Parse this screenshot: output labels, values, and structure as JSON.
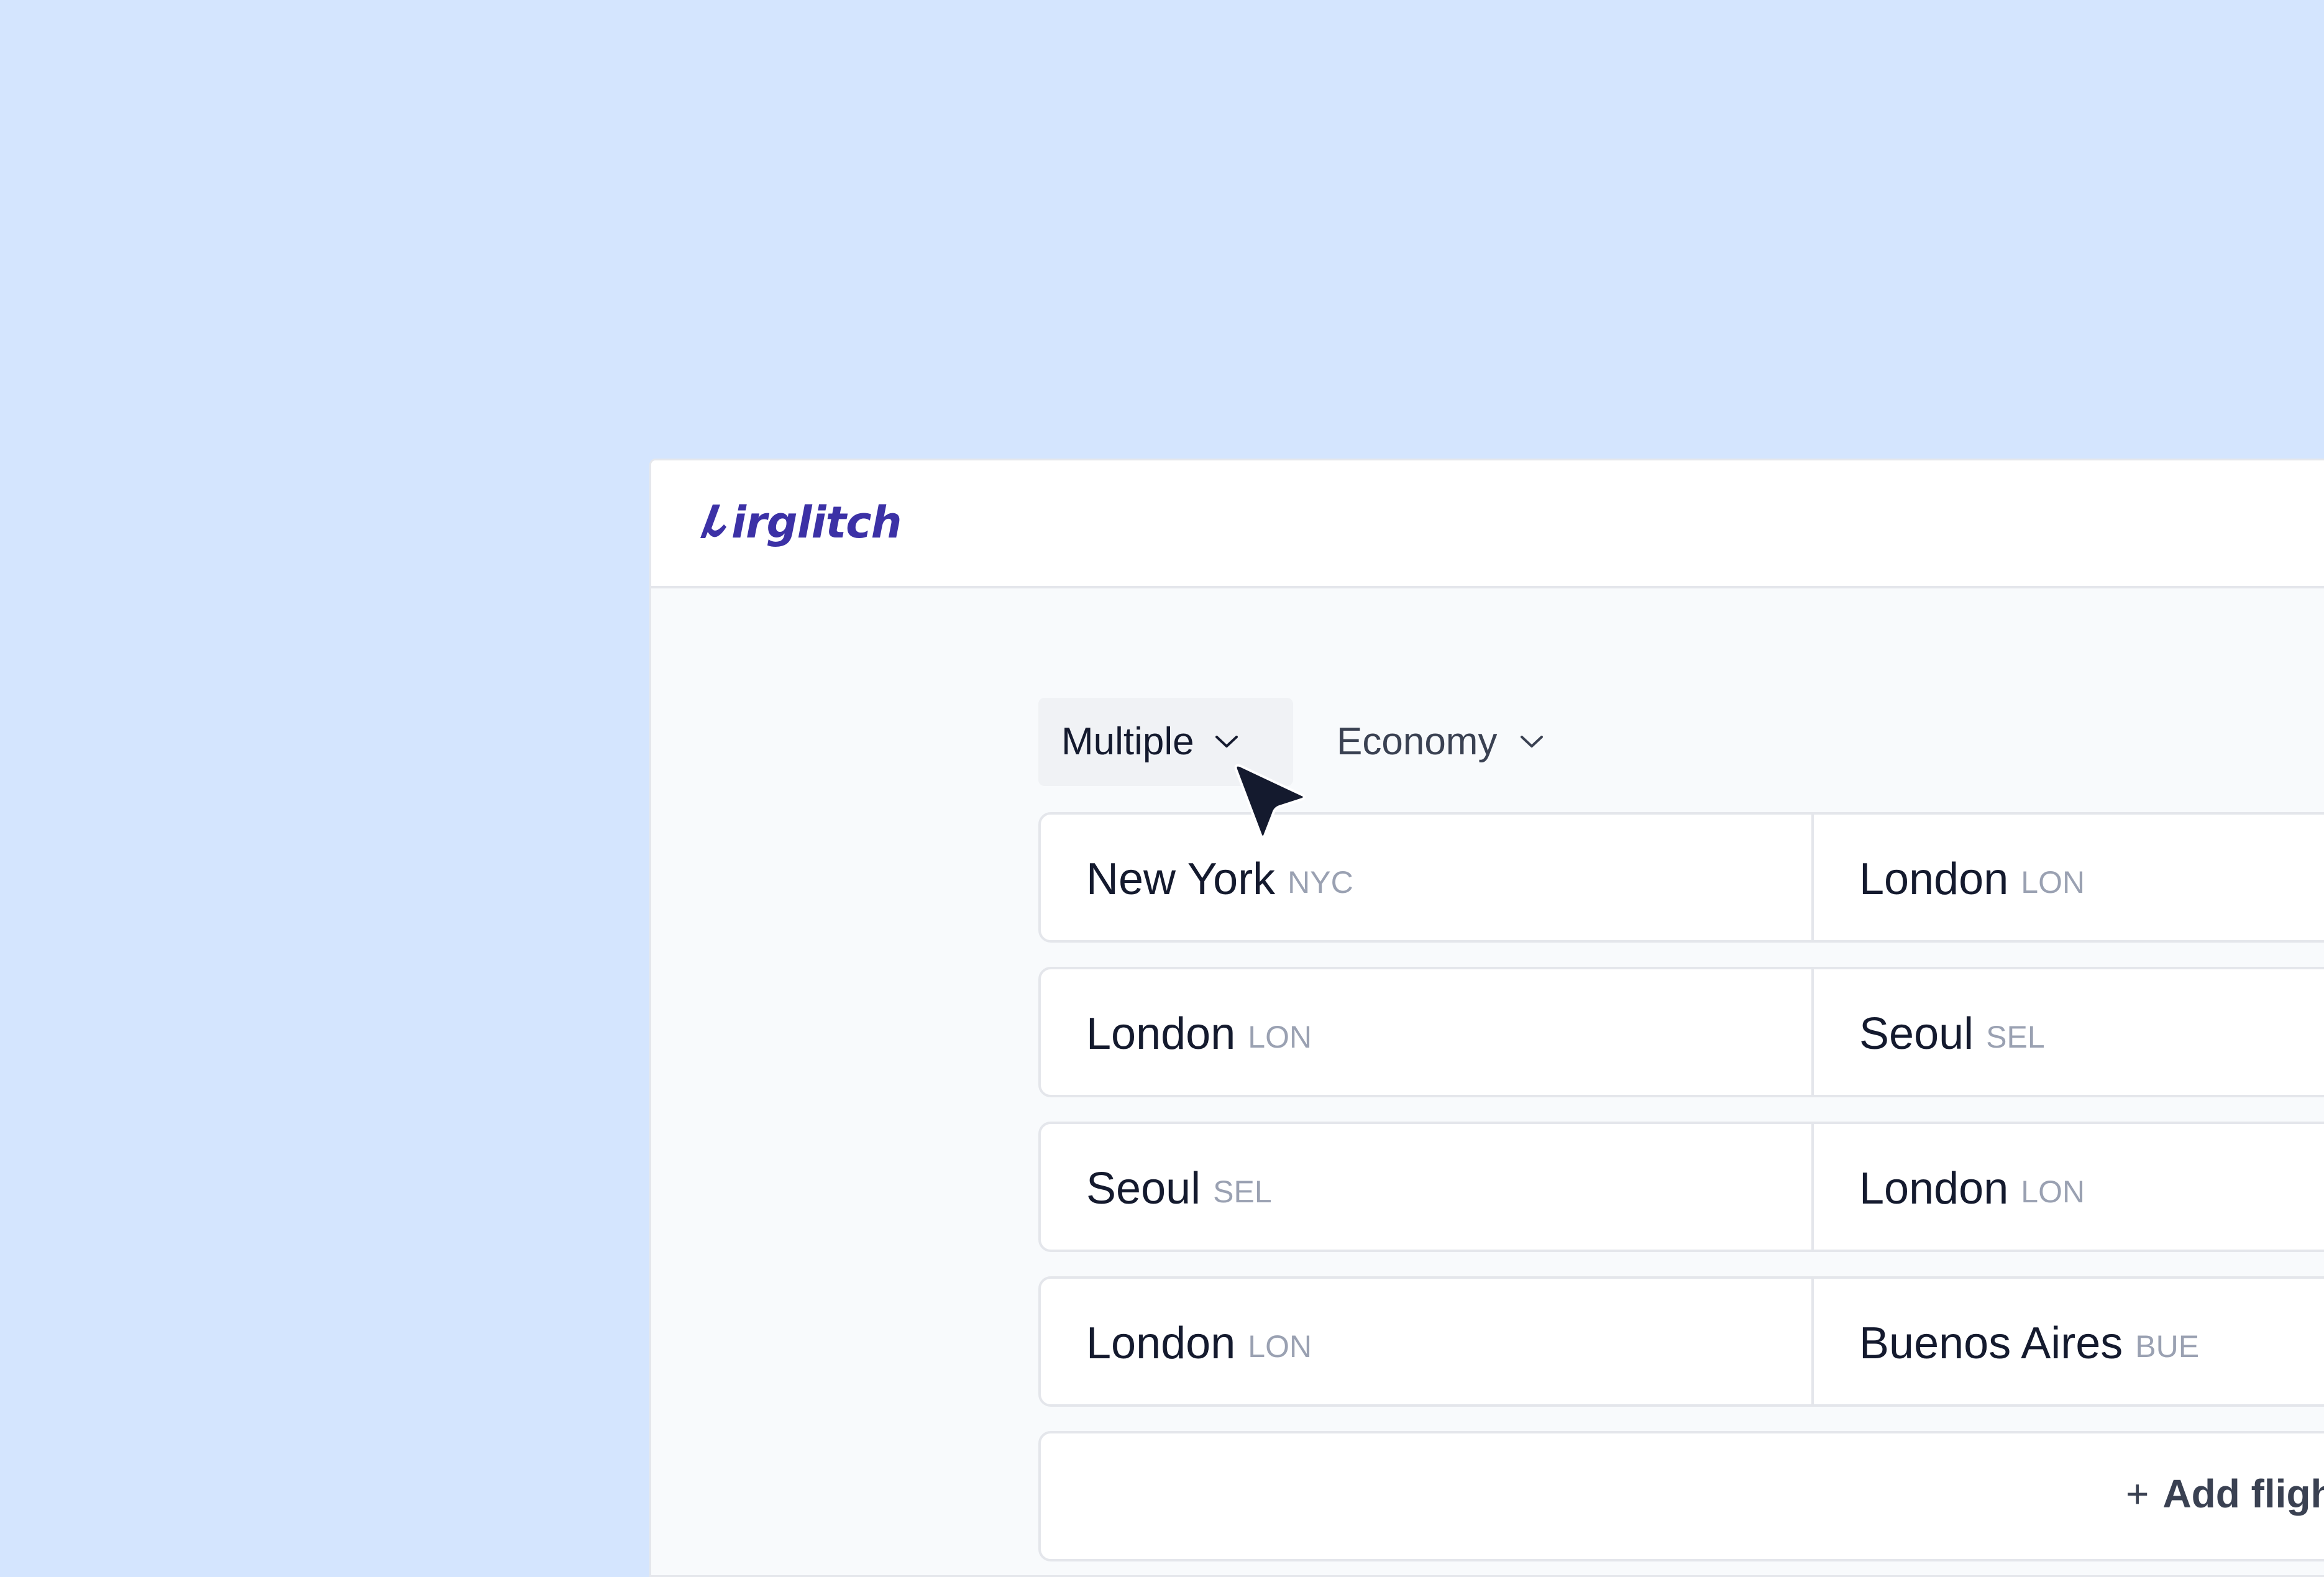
{
  "header": {
    "logo_text": "irglitch",
    "logo_icon": "airglitch-alpha-logo-icon"
  },
  "search": {
    "trip_type": {
      "label": "Multiple",
      "icon": "chevron-down-icon"
    },
    "cabin_class": {
      "label": "Economy",
      "icon": "chevron-down-icon"
    }
  },
  "flights": [
    {
      "origin": {
        "city": "New York",
        "code": "NYC"
      },
      "destination": {
        "city": "London",
        "code": "LON"
      }
    },
    {
      "origin": {
        "city": "London",
        "code": "LON"
      },
      "destination": {
        "city": "Seoul",
        "code": "SEL"
      }
    },
    {
      "origin": {
        "city": "Seoul",
        "code": "SEL"
      },
      "destination": {
        "city": "London",
        "code": "LON"
      }
    },
    {
      "origin": {
        "city": "London",
        "code": "LON"
      },
      "destination": {
        "city": "Buenos Aires",
        "code": "BUE"
      }
    }
  ],
  "add_flight": {
    "icon_glyph": "+",
    "label": "Add flight"
  },
  "cursor": {
    "icon": "mouse-pointer-icon"
  },
  "colors": {
    "page_background": "#d4e5fe",
    "brand": "#3c31a6",
    "text_primary": "#141a2e",
    "text_muted": "#9aa1b2",
    "border": "#e4e6eb"
  }
}
